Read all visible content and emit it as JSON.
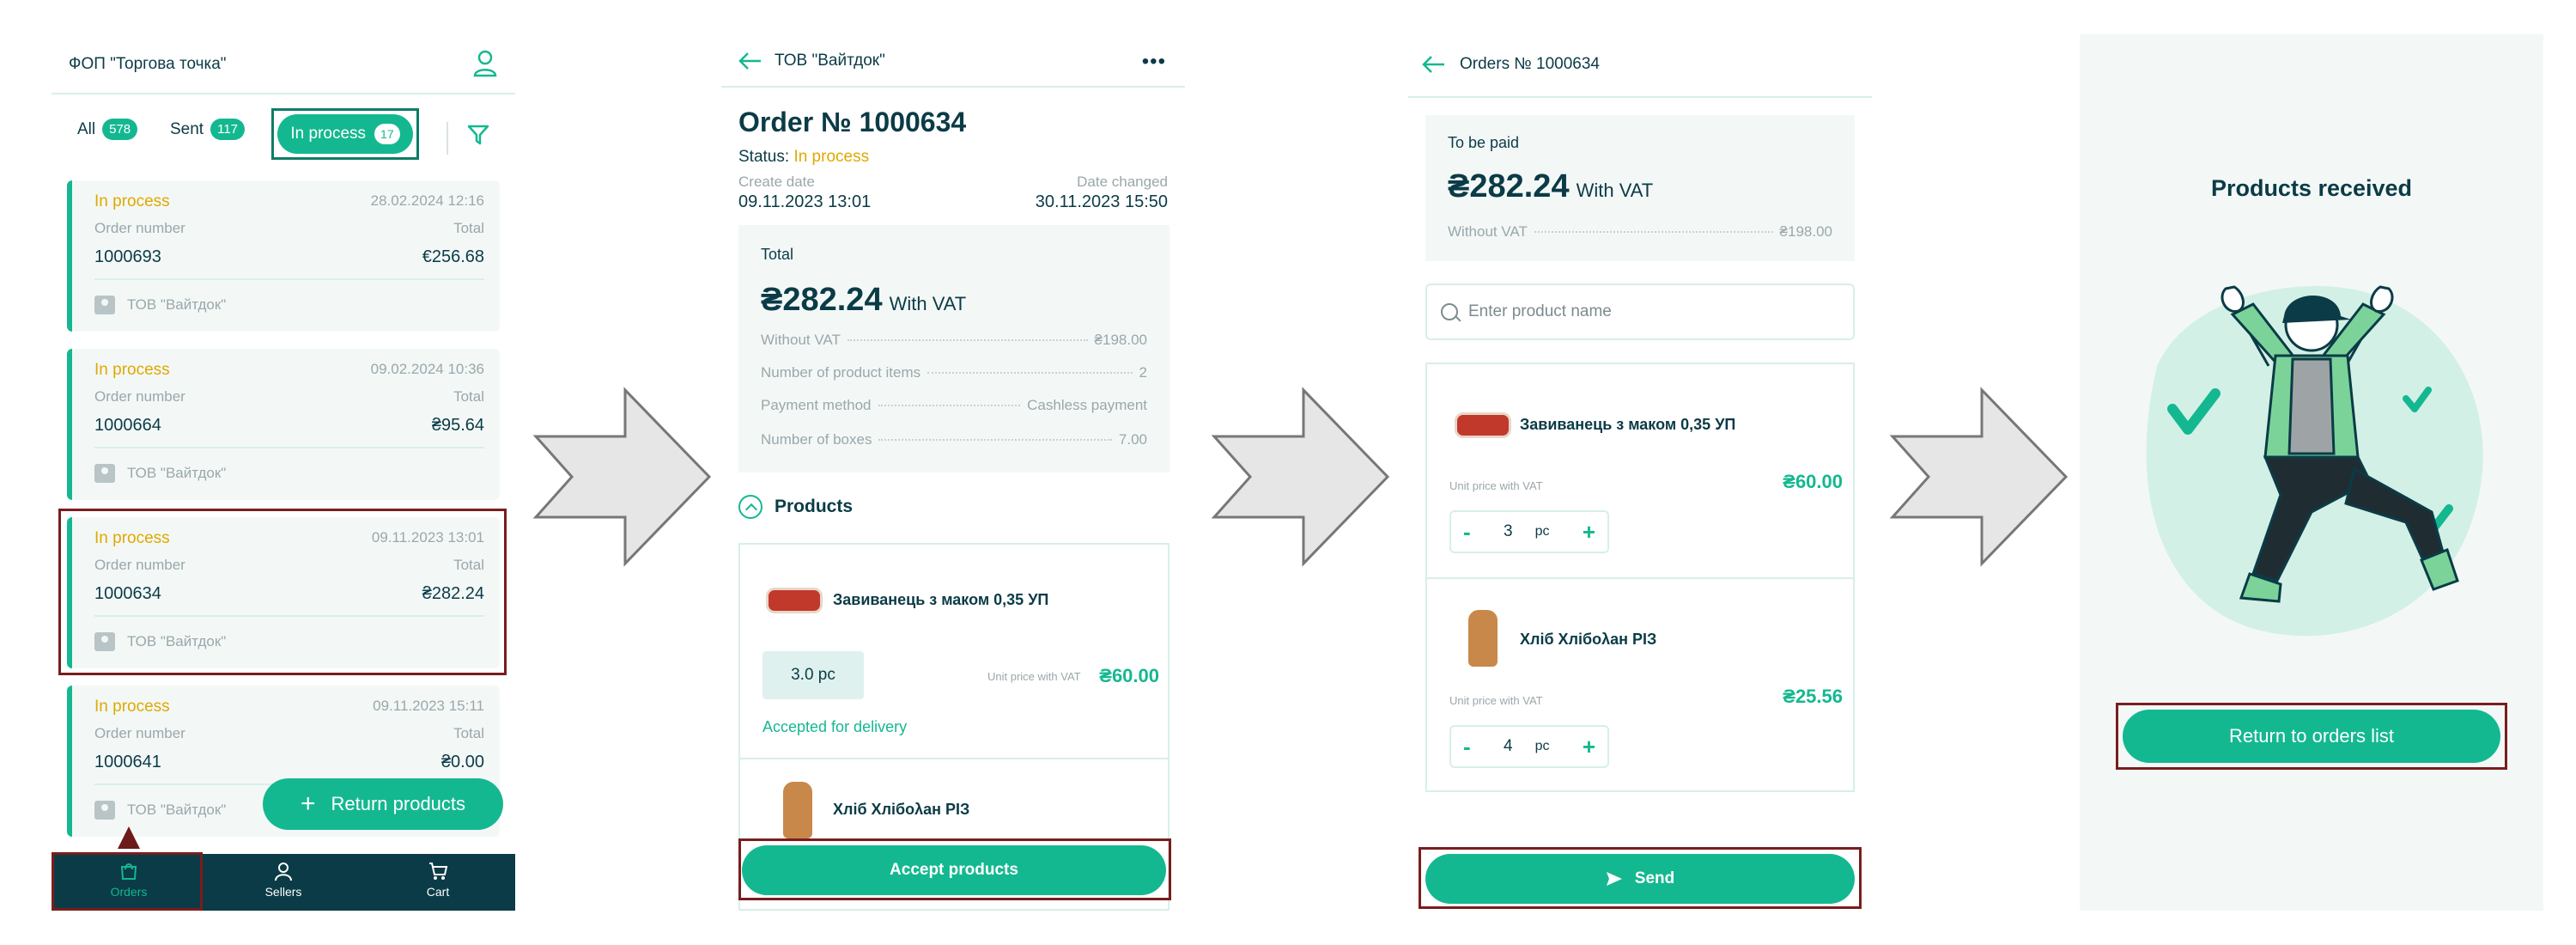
{
  "screen1": {
    "title": "ФОП \"Торгова точка\"",
    "tabs": [
      {
        "label": "All",
        "count": "578"
      },
      {
        "label": "Sent",
        "count": "117"
      },
      {
        "label": "In process",
        "count": "17"
      }
    ],
    "orders": [
      {
        "status": "In process",
        "date": "28.02.2024 12:16",
        "number_label": "Order number",
        "total_label": "Total",
        "number": "1000693",
        "total": "€256.68",
        "seller": "ТОВ \"Вайтдок\""
      },
      {
        "status": "In process",
        "date": "09.02.2024 10:36",
        "number_label": "Order number",
        "total_label": "Total",
        "number": "1000664",
        "total": "₴95.64",
        "seller": "ТОВ \"Вайтдок\""
      },
      {
        "status": "In process",
        "date": "09.11.2023 13:01",
        "number_label": "Order number",
        "total_label": "Total",
        "number": "1000634",
        "total": "₴282.24",
        "seller": "ТОВ \"Вайтдок\""
      },
      {
        "status": "In process",
        "date": "09.11.2023 15:11",
        "number_label": "Order number",
        "total_label": "Total",
        "number": "1000641",
        "total": "₴0.00",
        "seller": "ТОВ \"Вайтдок\""
      }
    ],
    "return_button": "Return products",
    "nav": {
      "orders": "Orders",
      "sellers": "Sellers",
      "cart": "Cart"
    }
  },
  "screen2": {
    "header_title": "ТОВ \"Вайтдок\"",
    "order_title": "Order № 1000634",
    "status_label": "Status:",
    "status_value": "In process",
    "create_label": "Create date",
    "create_value": "09.11.2023 13:01",
    "changed_label": "Date changed",
    "changed_value": "30.11.2023 15:50",
    "total_label": "Total",
    "total_amount": "₴282.24",
    "vat_note": "With VAT",
    "details": [
      {
        "label": "Without VAT",
        "value": "₴198.00"
      },
      {
        "label": "Number of product items",
        "value": "2"
      },
      {
        "label": "Payment method",
        "value": "Cashless payment"
      },
      {
        "label": "Number of boxes",
        "value": "7.00"
      }
    ],
    "products_label": "Products",
    "products": [
      {
        "name": "Завиванець з маком 0,35 УП",
        "qty": "3.0 pc",
        "unit_label": "Unit price with VAT",
        "price": "₴60.00",
        "note": "Accepted for delivery"
      },
      {
        "name": "Хліб Хлібολан РІЗ"
      }
    ],
    "accept_button": "Accept products"
  },
  "screen3": {
    "header_title": "Orders № 1000634",
    "pay_label": "To be paid",
    "pay_amount": "₴282.24",
    "vat_note": "With VAT",
    "without_vat_label": "Without VAT",
    "without_vat_value": "₴198.00",
    "search_placeholder": "Enter product name",
    "items": [
      {
        "name": "Завиванець з маком 0,35 УП",
        "unit_label": "Unit price with VAT",
        "price": "₴60.00",
        "qty": "3",
        "unit": "pc"
      },
      {
        "name": "Хліб Хлібολан РІЗ",
        "unit_label": "Unit price with VAT",
        "price": "₴25.56",
        "qty": "4",
        "unit": "pc"
      }
    ],
    "send_button": "Send"
  },
  "screen4": {
    "title": "Products received",
    "return_button": "Return to orders list"
  },
  "colors": {
    "accent": "#14b890",
    "dark": "#0b3b46",
    "status": "#e0a800",
    "highlight_frame": "#7a1d1d"
  },
  "icons": [
    "user-icon",
    "filter-icon",
    "seller-icon",
    "orders-icon",
    "sellers-icon",
    "cart-icon",
    "back-arrow-icon",
    "more-icon",
    "chevron-up-icon",
    "search-icon",
    "send-icon",
    "plus-icon"
  ]
}
